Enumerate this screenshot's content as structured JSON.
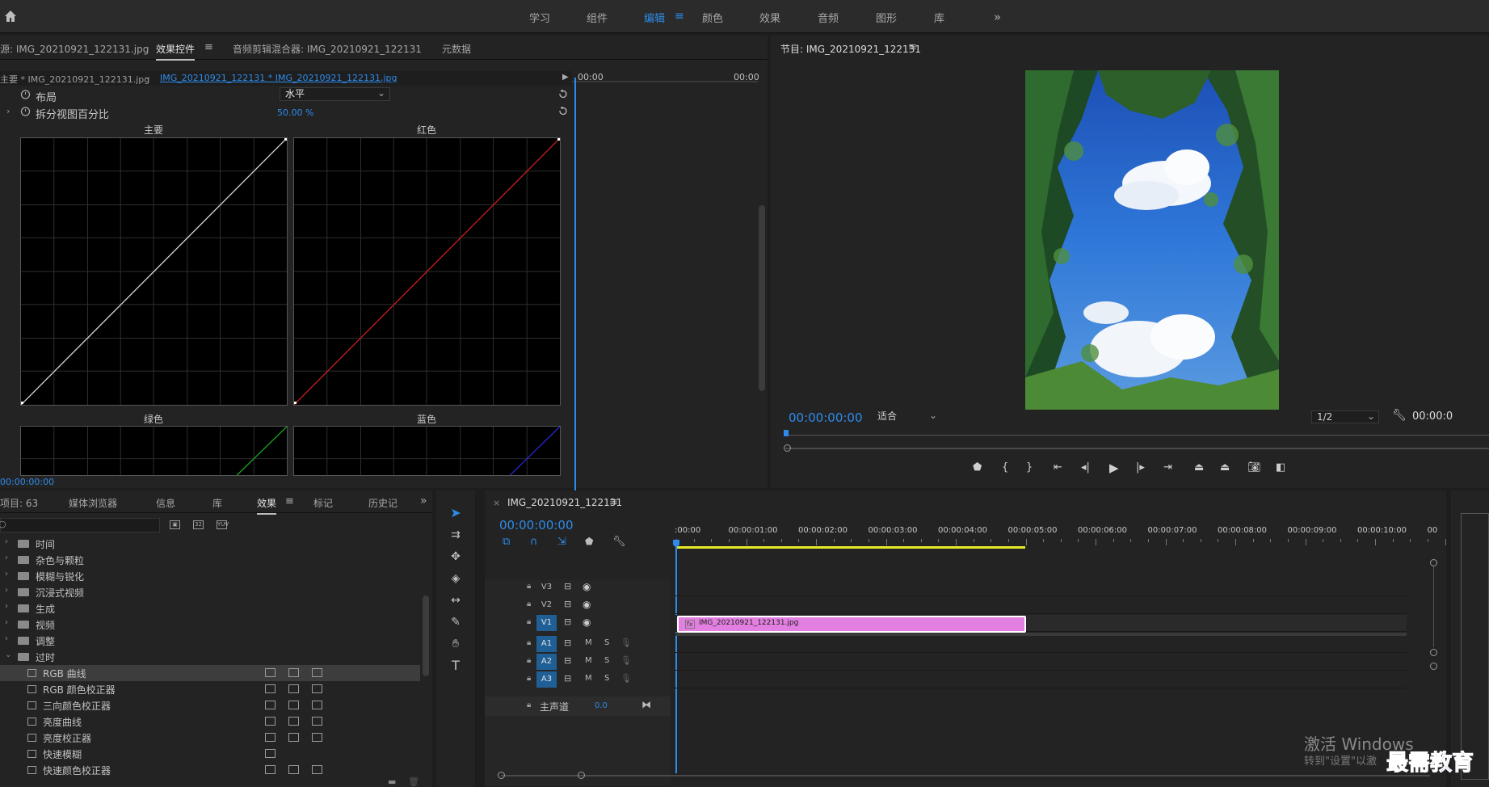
{
  "workspaces": [
    "学习",
    "组件",
    "编辑",
    "颜色",
    "效果",
    "音频",
    "图形",
    "库"
  ],
  "workspace_active": "编辑",
  "source_panel": {
    "tabs": [
      "源: IMG_20210921_122131.jpg",
      "效果控件",
      "音频剪辑混合器: IMG_20210921_122131",
      "元数据"
    ],
    "active_tab": "效果控件",
    "clip_master": "主要 * IMG_20210921_122131.jpg",
    "clip_sequence": "IMG_20210921_122131 * IMG_20210921_122131.jpg",
    "tc_left": "00:00",
    "tc_right": "00:00",
    "layout_label": "布局",
    "layout_value": "水平",
    "split_label": "拆分视图百分比",
    "split_value": "50.00 %",
    "graph_labels": {
      "master": "主要",
      "red": "红色",
      "green": "绿色",
      "blue": "蓝色"
    },
    "bottom_tc": "00:00:00:00"
  },
  "program_panel": {
    "title": "节目: IMG_20210921_122131",
    "timecode": "00:00:00:00",
    "fit": "适合",
    "resolution": "1/2",
    "tc_right": "00:00:0"
  },
  "project_panel": {
    "tabs": [
      "项目: 63",
      "媒体浏览器",
      "信息",
      "库",
      "效果",
      "标记",
      "历史记"
    ],
    "active_tab": "效果",
    "tree": [
      {
        "label": "时间",
        "type": "folder",
        "caret": "›"
      },
      {
        "label": "杂色与颗粒",
        "type": "folder",
        "caret": "›"
      },
      {
        "label": "模糊与锐化",
        "type": "folder",
        "caret": "›"
      },
      {
        "label": "沉浸式视频",
        "type": "folder",
        "caret": "›"
      },
      {
        "label": "生成",
        "type": "folder",
        "caret": "›"
      },
      {
        "label": "视频",
        "type": "folder",
        "caret": "›"
      },
      {
        "label": "调整",
        "type": "folder",
        "caret": "›"
      },
      {
        "label": "过时",
        "type": "folder",
        "caret": "⌄"
      },
      {
        "label": "RGB 曲线",
        "type": "effect",
        "selected": true
      },
      {
        "label": "RGB 颜色校正器",
        "type": "effect"
      },
      {
        "label": "三向颜色校正器",
        "type": "effect"
      },
      {
        "label": "亮度曲线",
        "type": "effect"
      },
      {
        "label": "亮度校正器",
        "type": "effect"
      },
      {
        "label": "快速模糊",
        "type": "effect"
      },
      {
        "label": "快速颜色校正器",
        "type": "effect"
      }
    ]
  },
  "timeline": {
    "sequence_name": "IMG_20210921_122131",
    "timecode": "00:00:00:00",
    "ruler": [
      ":00:00",
      "00:00:01:00",
      "00:00:02:00",
      "00:00:03:00",
      "00:00:04:00",
      "00:00:05:00",
      "00:00:06:00",
      "00:00:07:00",
      "00:00:08:00",
      "00:00:09:00",
      "00:00:10:00",
      "00"
    ],
    "video_tracks": [
      "V3",
      "V2",
      "V1"
    ],
    "audio_tracks": [
      "A1",
      "A2",
      "A3"
    ],
    "track_m": "M",
    "track_s": "S",
    "master_label": "主声道",
    "master_value": "0.0",
    "clip_name": "IMG_20210921_122131.jpg",
    "clip_fx": "fx",
    "clip_color": "#e37fe0"
  },
  "watermark": {
    "line1": "激活 Windows",
    "line2": "转到\"设置\"以激",
    "brand": "最需教育"
  },
  "colors": {
    "accent": "#2d8ceb",
    "curve_master": "#d8d8d8",
    "curve_red": "#c81e1e",
    "curve_green": "#1ea81e",
    "curve_blue": "#2828d8",
    "work_area": "#e8e82a"
  }
}
